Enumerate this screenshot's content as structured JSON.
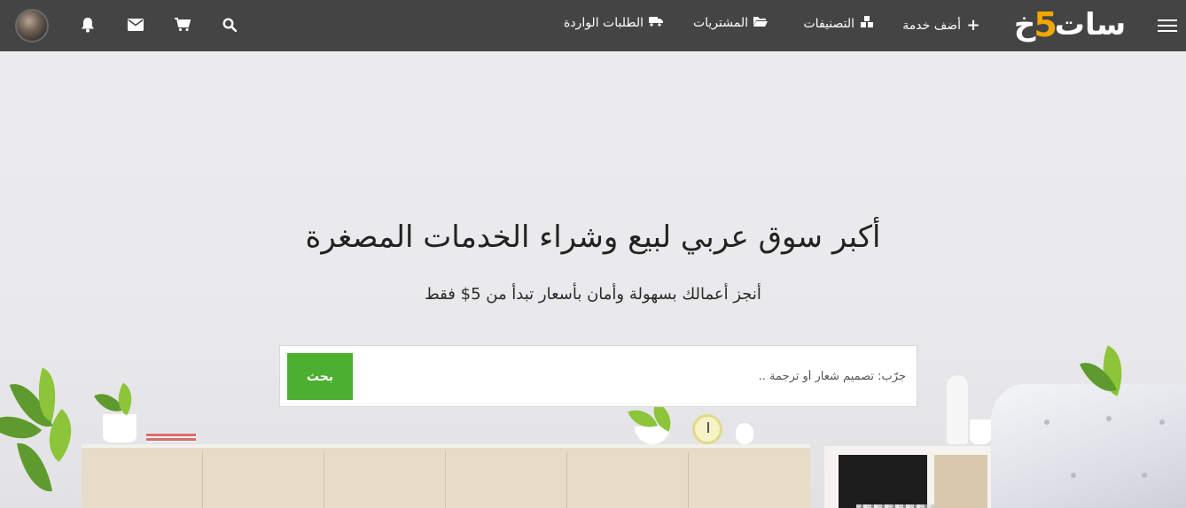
{
  "navbar": {
    "logo_text_start": "خ",
    "logo_text_mid": "5",
    "logo_text_end": "سات",
    "links": {
      "add_service": "أضف خدمة",
      "categories": "التصنيفات",
      "purchases": "المشتريات",
      "incoming_orders": "الطلبات الواردة"
    },
    "icons": {
      "menu": "hamburger-menu-icon",
      "add": "plus-icon",
      "categories": "cubes-icon",
      "purchases": "folder-open-icon",
      "incoming_orders": "truck-icon",
      "search": "search-icon",
      "cart": "cart-icon",
      "messages": "envelope-icon",
      "notifications": "bell-icon",
      "avatar": "user-avatar"
    }
  },
  "hero": {
    "title": "أكبر سوق عربي لبيع وشراء الخدمات المصغرة",
    "subtitle": "أنجز أعمالك بسهولة وأمان بأسعار تبدأ من 5$ فقط",
    "search_placeholder": "جرّب: تصميم شعار أو ترجمة ..",
    "search_button": "بحث"
  },
  "colors": {
    "navbar_bg": "#444444",
    "accent_green": "#4caf30",
    "logo_five": "#f0a800"
  }
}
